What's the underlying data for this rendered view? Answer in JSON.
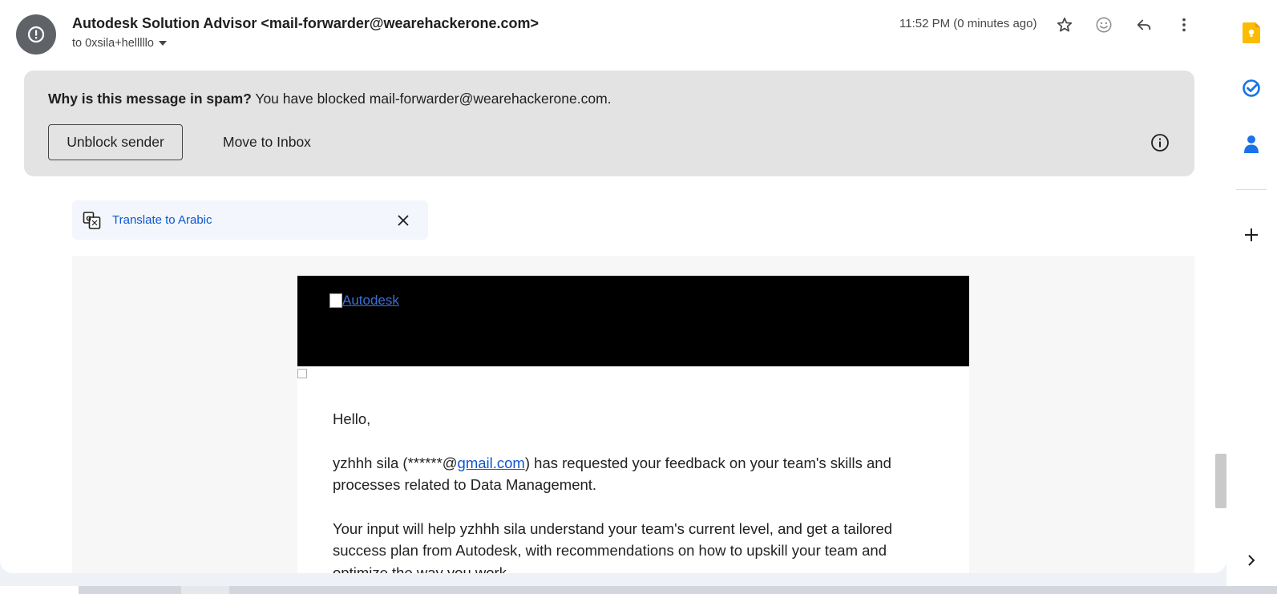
{
  "header": {
    "sender": "Autodesk Solution Advisor <mail-forwarder@wearehackerone.com>",
    "recipient": "to 0xsila+helllllo",
    "timestamp": "11:52 PM (0 minutes ago)",
    "icons": [
      "warning-icon",
      "star-icon",
      "emoji-icon",
      "reply-icon",
      "more-vert-icon"
    ]
  },
  "spam": {
    "question": "Why is this message in spam?",
    "reason": " You have blocked mail-forwarder@wearehackerone.com.",
    "unblock_label": "Unblock sender",
    "move_label": "Move to Inbox"
  },
  "translate": {
    "link": "Translate to Arabic"
  },
  "email": {
    "logo_alt": "Autodesk",
    "greeting": "Hello,",
    "p1_before": "yzhhh sila (******@",
    "p1_link": "gmail.com",
    "p1_after": ") has requested your feedback on your team's skills and processes related to Data Management.",
    "p2": "Your input will help yzhhh sila understand your team's current level, and get a tailored success plan from Autodesk, with recommendations on how to upskill your team and optimize the way you work."
  },
  "side_panel": {
    "icons": [
      "keep-icon",
      "tasks-icon",
      "contacts-icon",
      "add-icon",
      "chevron-right-icon"
    ]
  },
  "colors": {
    "accent": "#0b57d0",
    "keep": "#fbbc04",
    "banner_bg": "#e3e3e3",
    "email_header": "#000000"
  }
}
